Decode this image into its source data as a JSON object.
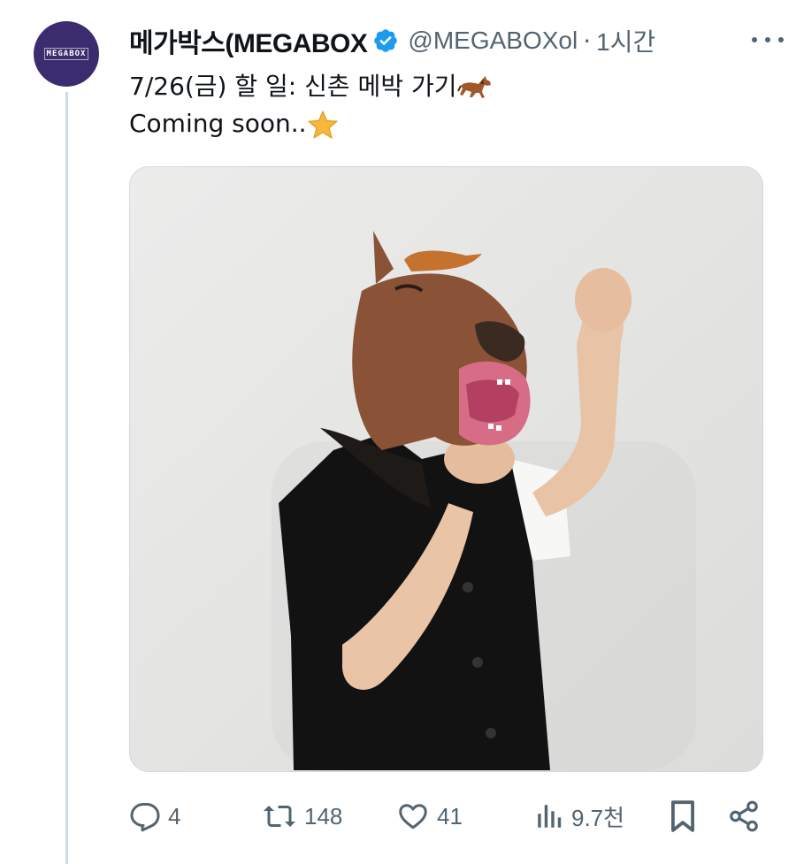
{
  "tweet": {
    "avatar_text": "MEGABOX",
    "display_name": "메가박스(MEGABOX",
    "handle": "@MEGABOXol",
    "separator": "·",
    "time": "1시간",
    "text_line1": "7/26(금) 할 일: 신촌 메박 가기",
    "text_line2": "Coming soon..",
    "emoji_line1": "horse-emoji",
    "emoji_line2": "star-emoji"
  },
  "media": {
    "description_icon": "photo"
  },
  "actions": {
    "reply_count": "4",
    "repost_count": "148",
    "like_count": "41",
    "views_count": "9.7천"
  },
  "colors": {
    "verified": "#1d9bf0",
    "secondary_text": "#536471",
    "avatar_bg": "#3a2c6e"
  }
}
